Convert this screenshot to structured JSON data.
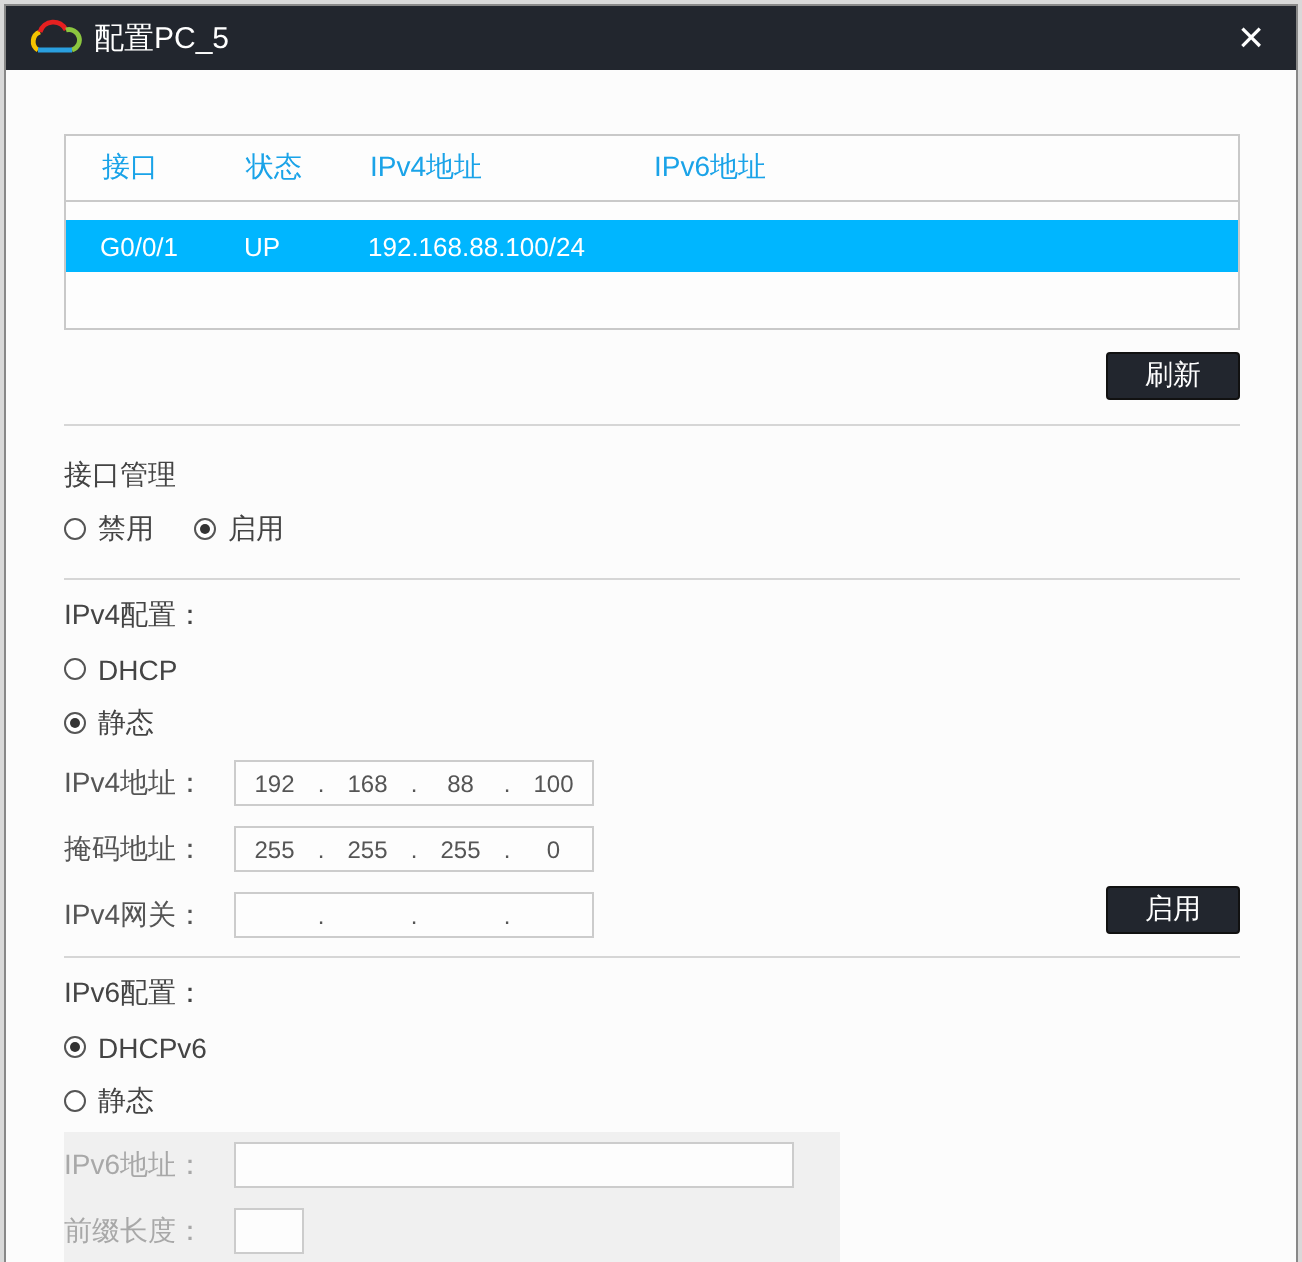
{
  "window": {
    "title": "配置PC_5",
    "close": "×"
  },
  "interface_table": {
    "columns": [
      "接口",
      "状态",
      "IPv4地址",
      "IPv6地址"
    ],
    "rows": [
      {
        "cells": [
          "G0/0/1",
          "UP",
          "192.168.88.100/24"
        ],
        "selected": true
      }
    ]
  },
  "refresh_button": "刷新",
  "interface_management": {
    "title": "接口管理",
    "options": [
      {
        "label": "禁用",
        "selected": false
      },
      {
        "label": "启用",
        "selected": true
      }
    ]
  },
  "ipv4": {
    "title": "IPv4配置：",
    "options": [
      {
        "label": "DHCP",
        "selected": false
      },
      {
        "label": "静态",
        "selected": true
      }
    ],
    "fields": [
      {
        "label": "IPv4地址：",
        "octets": [
          "192",
          "168",
          "88",
          "100"
        ]
      },
      {
        "label": "掩码地址：",
        "octets": [
          "255",
          "255",
          "255",
          "0"
        ]
      },
      {
        "label": "IPv4网关："
      }
    ],
    "separator": ".",
    "apply_button": "启用"
  },
  "ipv6": {
    "title": "IPv6配置：",
    "options": [
      {
        "label": "DHCPv6",
        "selected": true
      },
      {
        "label": "静态",
        "selected": false
      }
    ],
    "disabled": true,
    "fields": [
      {
        "label": "IPv6地址：",
        "kind": "wide"
      },
      {
        "label": "前缀长度：",
        "kind": "short"
      }
    ]
  }
}
